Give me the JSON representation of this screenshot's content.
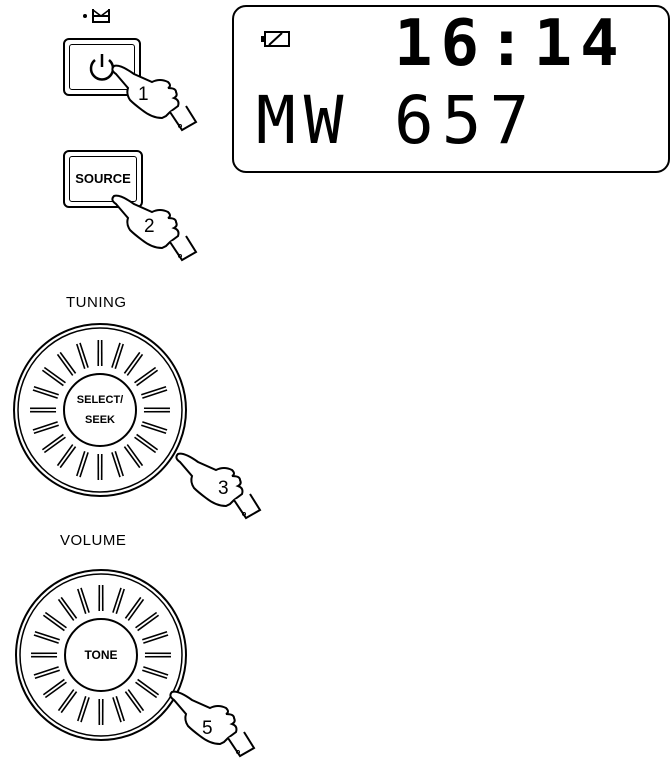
{
  "standby_symbol": "•⊨⊣",
  "power_button": {
    "icon": "power-icon",
    "step": "1"
  },
  "source_button": {
    "label": "SOURCE",
    "step": "2"
  },
  "tuning": {
    "label": "TUNING",
    "center_line1": "SELECT/",
    "center_line2": "SEEK",
    "step": "3"
  },
  "volume": {
    "label": "VOLUME",
    "center": "TONE",
    "step": "5"
  },
  "display": {
    "battery_icon": "battery-icon",
    "time": "16:14",
    "band": "MW",
    "frequency": "657"
  }
}
